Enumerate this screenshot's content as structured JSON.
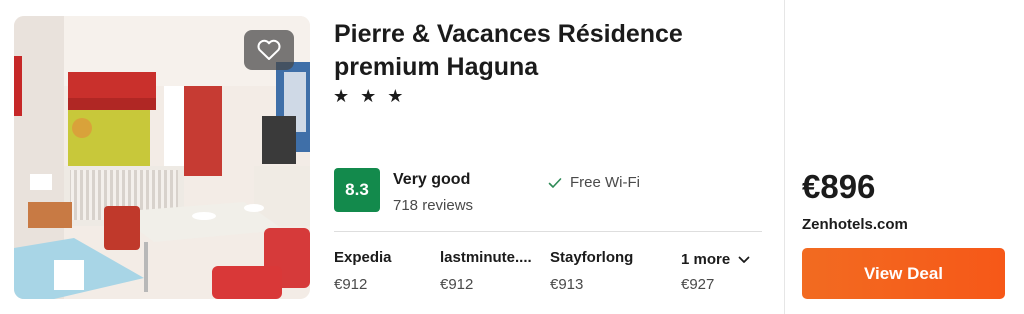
{
  "hotel": {
    "name": "Pierre & Vacances Résidence premium Haguna",
    "stars": "★ ★ ★",
    "favorite_icon": "heart-outline-icon",
    "rating": {
      "score": "8.3",
      "label": "Very good",
      "reviews": "718 reviews",
      "badge_color": "#138a4c"
    },
    "amenities": [
      {
        "label": "Free Wi-Fi",
        "icon": "check-icon"
      }
    ]
  },
  "providers": [
    {
      "name": "Expedia",
      "price": "€912"
    },
    {
      "name": "lastminute....",
      "price": "€912"
    },
    {
      "name": "Stayforlong",
      "price": "€913"
    }
  ],
  "more_providers": {
    "label": "1 more",
    "price": "€927",
    "icon": "chevron-down-icon"
  },
  "deal": {
    "price": "€896",
    "source": "Zenhotels.com",
    "button_label": "View Deal",
    "button_color": "#f26b21"
  }
}
